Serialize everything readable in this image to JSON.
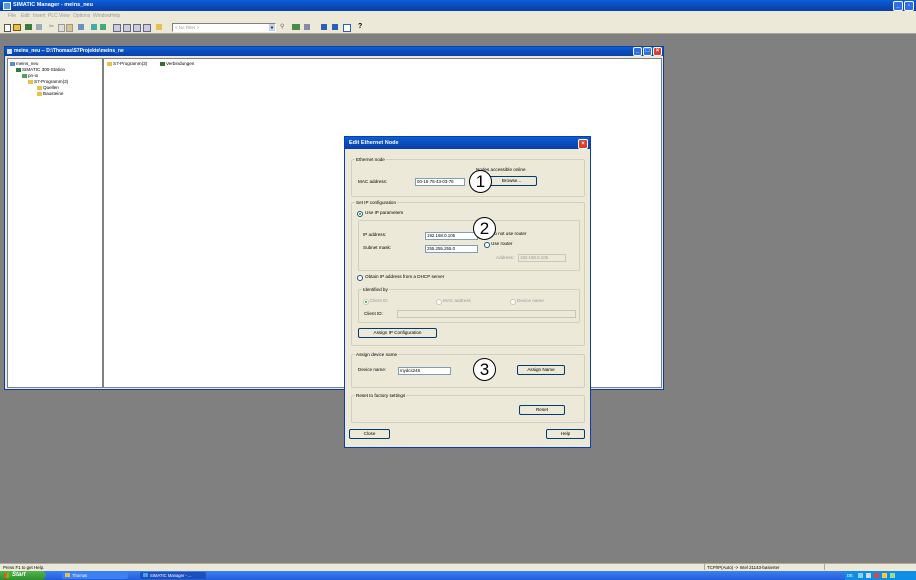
{
  "app": {
    "title": "SIMATIC Manager - meins_neu",
    "menu": [
      "File",
      "Edit",
      "Insert",
      "PLC",
      "View",
      "Options",
      "Window",
      "Help"
    ],
    "filter_value": "< No Filter >"
  },
  "child_window": {
    "title": "meins_neu -- D:\\Thomas\\S7Projekte\\meins_ne",
    "tree": [
      "meins_neu",
      "SIMATIC 300-Station",
      "pn-io",
      "S7-Programm(3)",
      "Quellen",
      "Bausteine"
    ],
    "items": [
      "S7-Programm(3)",
      "Verbindungen"
    ]
  },
  "dialog": {
    "title": "Edit Ethernet Node",
    "ethernet_node": {
      "group": "Ethernet node",
      "nodes_label": "Nodes accessible online",
      "mac_label": "MAC address:",
      "mac_value": "00-15-78-43-03-76",
      "browse_label": "Browse..."
    },
    "ip_config": {
      "group": "Set IP configuration",
      "use_ip": "Use IP parameters",
      "ip_label": "IP address:",
      "ip_value": "192.168.0.105",
      "subnet_label": "Subnet mask:",
      "subnet_value": "255.255.255.0",
      "gateway_no": "Do not use router",
      "gateway_yes": "Use router",
      "router_address_label": "Address:",
      "router_address_value": "192.168.0.105",
      "dhcp": "Obtain IP address from a DHCP server",
      "identified_by": "Identified by",
      "client_id_radio": "Client ID",
      "mac_radio": "MAC address",
      "device_name_radio": "Device name",
      "client_id_label": "Client ID:",
      "client_id_value": "",
      "assign_ip_button": "Assign IP Configuration"
    },
    "device_name": {
      "group": "Assign device name",
      "label": "Device name:",
      "value": "mydcs246",
      "assign_button": "Assign Name"
    },
    "reset": {
      "group": "Reset to factory settings",
      "button": "Reset"
    },
    "close_button": "Close",
    "help_button": "Help"
  },
  "callouts": [
    "1",
    "2",
    "3"
  ],
  "status_bar": {
    "left": "Press F1 to get Help.",
    "right": "TCP/IP(Auto) -> Intel 21143-basierter"
  },
  "taskbar": {
    "start": "Start",
    "items": [
      "Thomas",
      "SIMATIC Manager - ..."
    ],
    "tray": "DE"
  }
}
